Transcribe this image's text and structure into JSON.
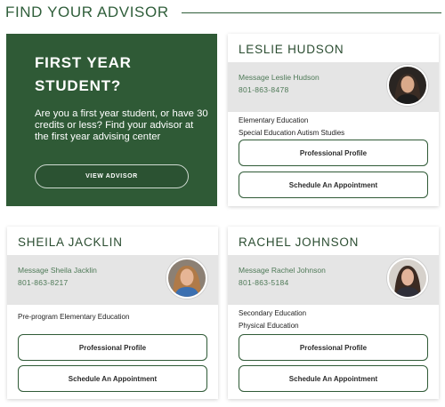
{
  "header": {
    "title": "FIND YOUR ADVISOR"
  },
  "promo": {
    "title_line1": "FIRST YEAR",
    "title_line2": "STUDENT?",
    "text": "Are you a first year student, or have 30 credits or less? Find your advisor at the first year advising center",
    "button_label": "VIEW ADVISOR"
  },
  "advisors": [
    {
      "name": "LESLIE HUDSON",
      "message": "Message Leslie Hudson",
      "phone": "801-863-8478",
      "specialties": [
        "Elementary Education",
        "Special Education Autism Studies"
      ],
      "profile_label": "Professional Profile",
      "appointment_label": "Schedule An Appointment"
    },
    {
      "name": "SHEILA JACKLIN",
      "message": "Message Sheila Jacklin",
      "phone": "801-863-8217",
      "specialties": [
        "Pre-program Elementary Education"
      ],
      "profile_label": "Professional Profile",
      "appointment_label": "Schedule An Appointment"
    },
    {
      "name": "RACHEL JOHNSON",
      "message": "Message Rachel Johnson",
      "phone": "801-863-5184",
      "specialties": [
        "Secondary Education",
        "Physical Education"
      ],
      "profile_label": "Professional Profile",
      "appointment_label": "Schedule An Appointment"
    }
  ],
  "colors": {
    "brand_green": "#2f5a36",
    "link_green": "#4f7a58",
    "contact_bg": "#e5e5e5"
  }
}
